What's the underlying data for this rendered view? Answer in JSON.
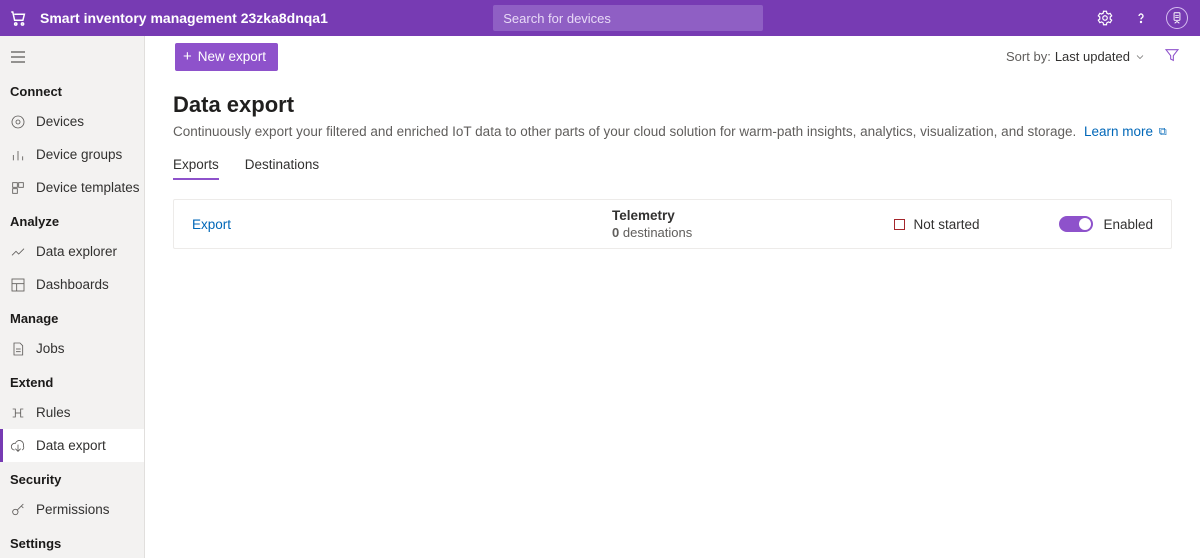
{
  "header": {
    "app_title": "Smart inventory management 23zka8dnqa1",
    "search_placeholder": "Search for devices"
  },
  "sidebar": {
    "sections": [
      {
        "label": "Connect",
        "items": [
          {
            "name": "devices",
            "label": "Devices"
          },
          {
            "name": "device-groups",
            "label": "Device groups"
          },
          {
            "name": "device-templates",
            "label": "Device templates"
          }
        ]
      },
      {
        "label": "Analyze",
        "items": [
          {
            "name": "data-explorer",
            "label": "Data explorer"
          },
          {
            "name": "dashboards",
            "label": "Dashboards"
          }
        ]
      },
      {
        "label": "Manage",
        "items": [
          {
            "name": "jobs",
            "label": "Jobs"
          }
        ]
      },
      {
        "label": "Extend",
        "items": [
          {
            "name": "rules",
            "label": "Rules"
          },
          {
            "name": "data-export",
            "label": "Data export",
            "active": true
          }
        ]
      },
      {
        "label": "Security",
        "items": [
          {
            "name": "permissions",
            "label": "Permissions"
          }
        ]
      },
      {
        "label": "Settings",
        "items": []
      }
    ]
  },
  "toolbar": {
    "new_export_label": "New export",
    "sort_label": "Sort by:",
    "sort_value": "Last updated"
  },
  "page": {
    "title": "Data export",
    "description": "Continuously export your filtered and enriched IoT data to other parts of your cloud solution for warm-path insights, analytics, visualization, and storage.",
    "learn_more": "Learn more"
  },
  "tabs": {
    "exports": "Exports",
    "destinations": "Destinations",
    "active": "exports"
  },
  "exports": [
    {
      "name": "Export",
      "type": "Telemetry",
      "destinations_count": 0,
      "destinations_word": "destinations",
      "status": "Not started",
      "enabled_label": "Enabled",
      "enabled": true
    }
  ]
}
